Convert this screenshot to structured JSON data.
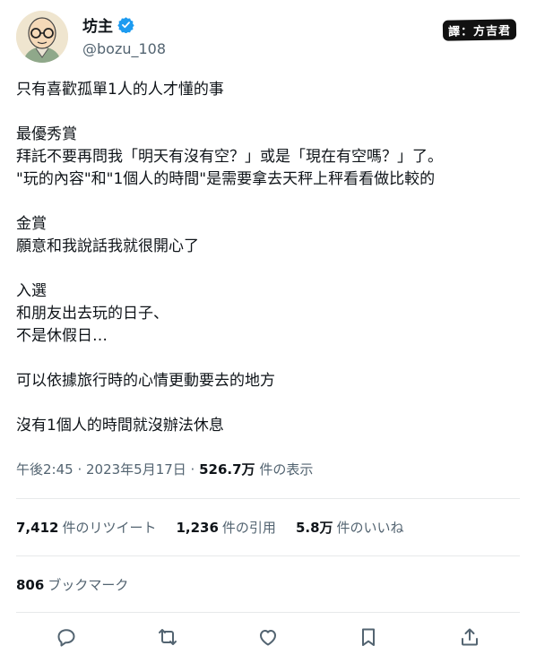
{
  "author": {
    "name": "坊主",
    "handle": "@bozu_108",
    "avatar": "avatar-monk-glasses",
    "verified_icon": "verified-badge-icon",
    "verified_color": "#1d9bf0"
  },
  "watermark": "譯：方吉君",
  "tweet_lines": [
    "只有喜歡孤單1人的人才懂的事",
    "",
    "最優秀賞",
    "拜託不要再問我「明天有沒有空？」或是「現在有空嗎？」了。",
    "\"玩的內容\"和\"1個人的時間\"是需要拿去天秤上秤看看做比較的",
    "",
    "金賞",
    "願意和我說話我就很開心了",
    "",
    "入選",
    "和朋友出去玩的日子、",
    "不是休假日…",
    "",
    "可以依據旅行時的心情更動要去的地方",
    "",
    "沒有1個人的時間就沒辦法休息"
  ],
  "meta": {
    "time": "午後2:45 · 2023年5月17日 · ",
    "views": "526.7万",
    "views_label": " 件の表示"
  },
  "stats": {
    "retweets_count": "7,412",
    "retweets_label": "件のリツイート",
    "quotes_count": "1,236",
    "quotes_label": "件の引用",
    "likes_count": "5.8万",
    "likes_label": "件のいいね"
  },
  "bookmarks": {
    "count": "806",
    "label": "ブックマーク"
  },
  "actions": [
    "reply-icon",
    "retweet-icon",
    "like-icon",
    "bookmark-icon",
    "share-icon"
  ]
}
